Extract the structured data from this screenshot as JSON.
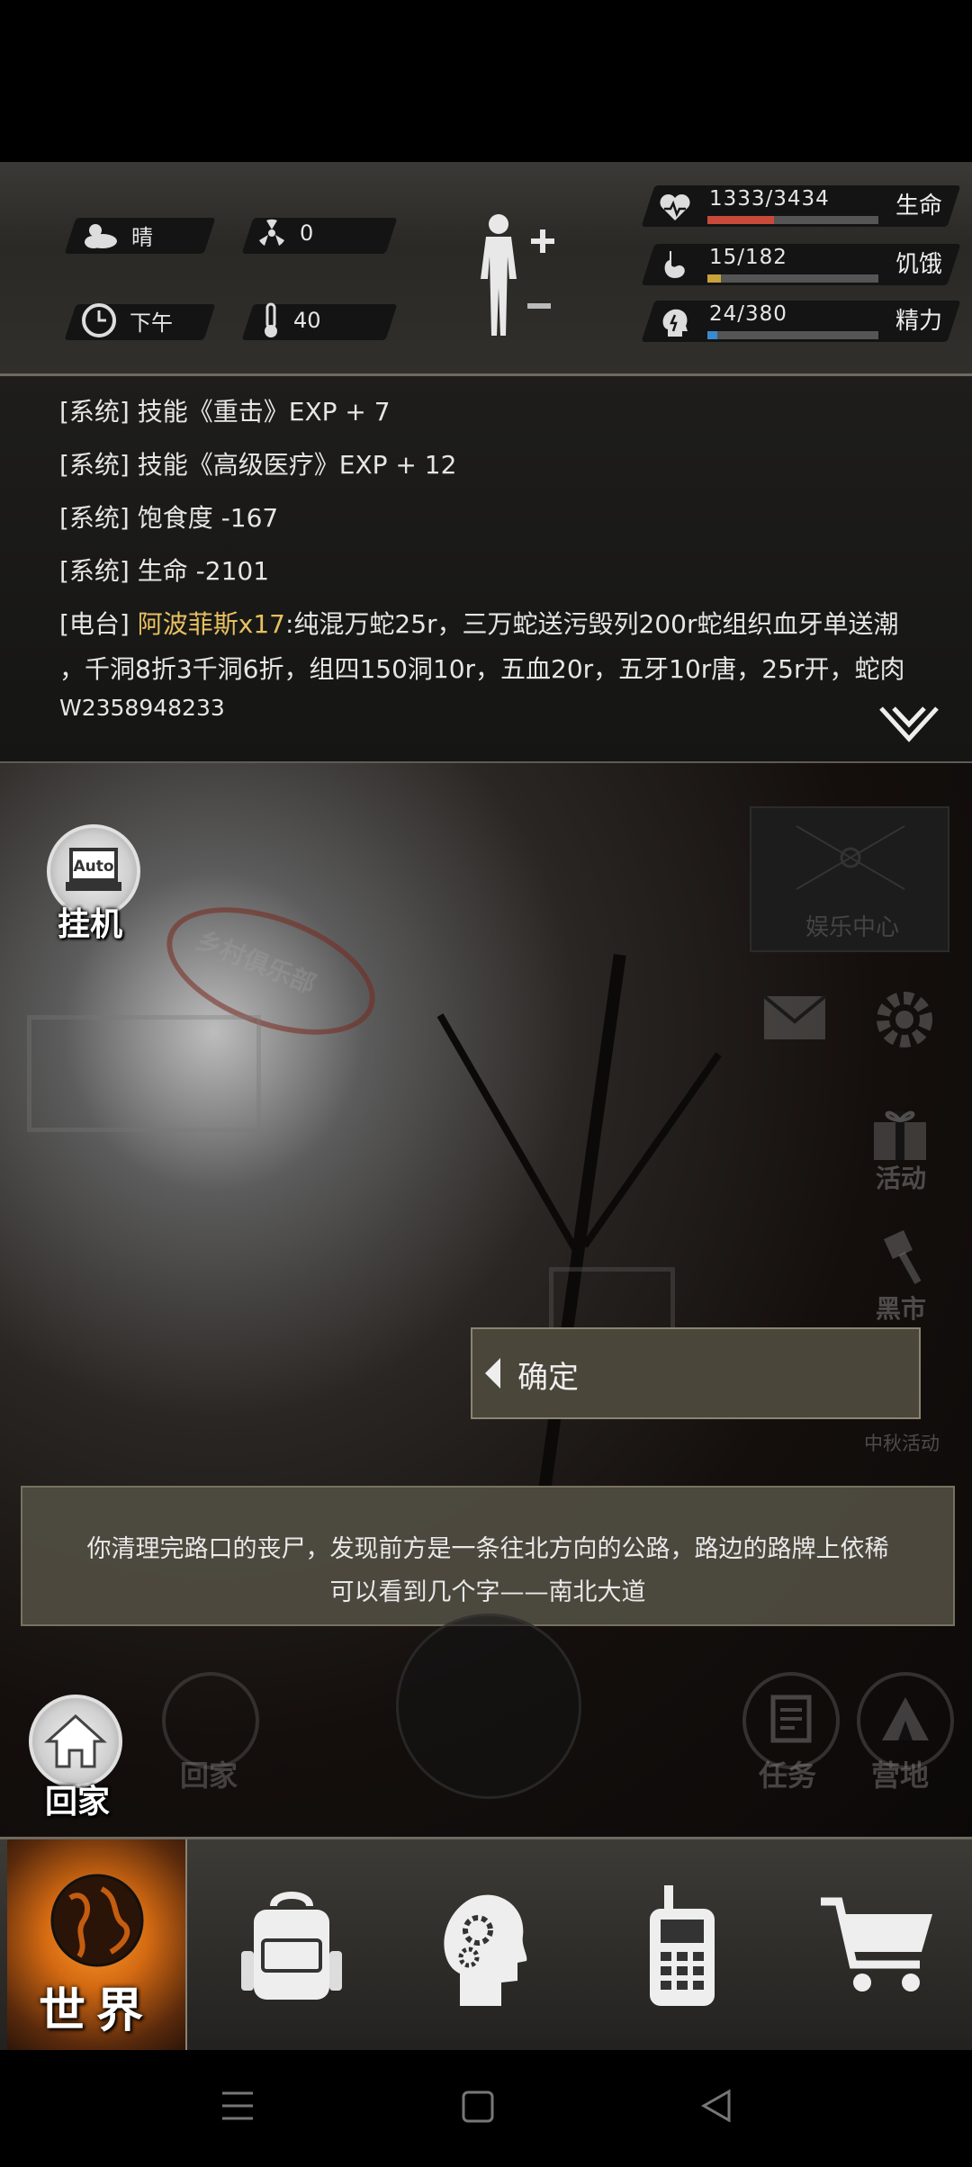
{
  "status": {
    "weather": {
      "icon": "cloud-sun-icon",
      "label": "晴"
    },
    "radiation": {
      "icon": "radiation-icon",
      "value": "0"
    },
    "time": {
      "icon": "clock-icon",
      "label": "下午"
    },
    "temperature": {
      "icon": "thermometer-icon",
      "value": "40"
    },
    "stats": [
      {
        "key": "hp",
        "icon": "heart-icon",
        "value": "1333/3434",
        "label": "生命",
        "fraction": 0.39,
        "color": "#c84a3a"
      },
      {
        "key": "hunger",
        "icon": "stomach-icon",
        "value": "15/182",
        "label": "饥饿",
        "fraction": 0.08,
        "color": "#c8a23a"
      },
      {
        "key": "energy",
        "icon": "brain-icon",
        "value": "24/380",
        "label": "精力",
        "fraction": 0.06,
        "color": "#3a8ad0"
      }
    ]
  },
  "log": {
    "lines": [
      "[系统] 技能《重击》EXP + 7",
      "[系统] 技能《高级医疗》EXP + 12",
      "[系统] 饱食度 -167",
      "[系统] 生命 -2101"
    ],
    "radio": {
      "tag": "[电台]",
      "name": "阿波菲斯x17",
      "text1": ":纯混万蛇25r，三万蛇送污毁列200r蛇组织血牙单送潮",
      "text2": "，千洞8折3千洞6折，组四150洞10r，五血20r，五牙10r唐，25r开，蛇肉",
      "text3": "W2358948233"
    }
  },
  "scene": {
    "auto_label": "Auto",
    "hangup_label": "挂机",
    "entertainment_label": "娱乐中心",
    "activity_label": "活动",
    "blackmarket_label": "黑市",
    "midautumn_label": "中秋活动",
    "club_sign": "乡村俱乐部",
    "confirm_label": "确定",
    "message_line1": "你清理完路口的丧尸，发现前方是一条往北方向的公路，路边的路牌上依稀",
    "message_line2": "可以看到几个字——南北大道",
    "home_label": "回家",
    "home_dim_label": "回家",
    "task_label": "任务",
    "camp_label": "营地"
  },
  "tabs": {
    "world_label": "世界",
    "items": [
      {
        "name": "backpack-icon"
      },
      {
        "name": "skills-head-icon"
      },
      {
        "name": "walkie-talkie-icon"
      },
      {
        "name": "shopping-cart-icon"
      }
    ]
  }
}
